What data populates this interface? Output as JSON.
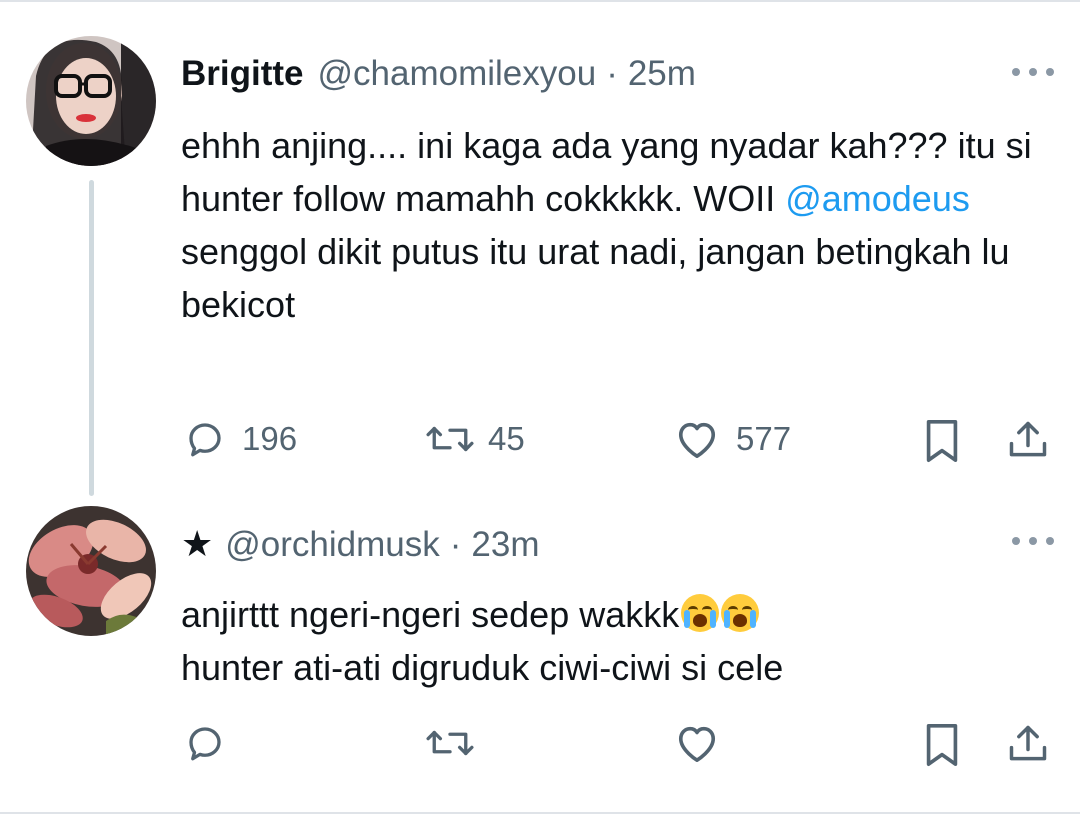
{
  "colors": {
    "text": "#0f1419",
    "secondary": "#536471",
    "mention": "#1d9bf0",
    "thread_line": "#cfd9de"
  },
  "tweets": [
    {
      "name": "Brigitte",
      "handle": "@chamomilexyou",
      "separator": "·",
      "time": "25m",
      "text_parts": [
        "ehhh anjing.... ini kaga ada yang nyadar kah??? itu si hunter follow mamahh cokkkkk. WOII ",
        "@amodeus",
        " senggol dikit putus itu urat nadi, jangan betingkah lu bekicot"
      ],
      "actions": {
        "reply_icon": "reply-icon",
        "replies": "196",
        "retweet_icon": "retweet-icon",
        "retweets": "45",
        "like_icon": "heart-icon",
        "likes": "577",
        "bookmark_icon": "bookmark-icon",
        "share_icon": "share-icon"
      }
    },
    {
      "prefix_icon": "★",
      "handle": "@orchidmusk",
      "separator": "·",
      "time": "23m",
      "text_line1": "anjirttt ngeri-ngeri sedep wakkk",
      "emoji": "😭😭",
      "text_line2": "hunter ati-ati digruduk ciwi-ciwi si cele",
      "actions": {
        "reply_icon": "reply-icon",
        "retweet_icon": "retweet-icon",
        "like_icon": "heart-icon",
        "bookmark_icon": "bookmark-icon",
        "share_icon": "share-icon"
      }
    }
  ]
}
